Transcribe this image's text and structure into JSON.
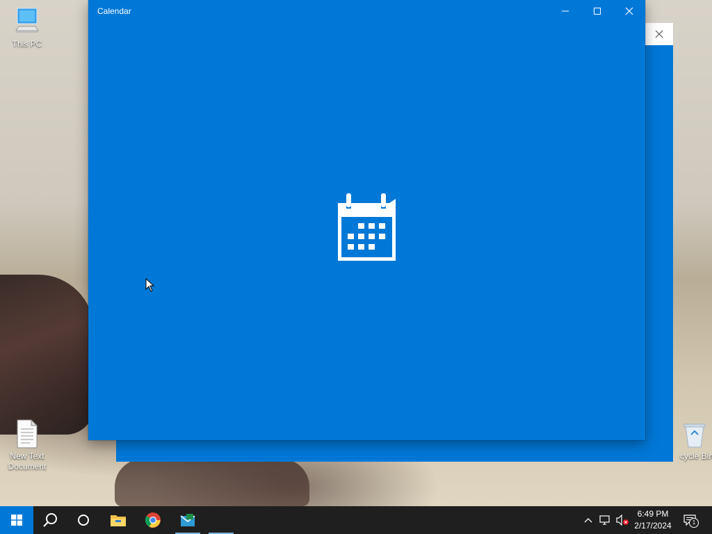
{
  "desktop": {
    "icons": [
      {
        "label": "This PC",
        "icon": "computer-icon"
      },
      {
        "label": "New Text Document",
        "icon": "text-document-icon"
      },
      {
        "label": "cycle Bin",
        "icon": "recycle-bin-icon"
      }
    ]
  },
  "window": {
    "title": "Calendar",
    "accent": "#0078d7",
    "splash_icon": "calendar-icon",
    "controls": [
      "minimize",
      "maximize",
      "close"
    ]
  },
  "background_window": {
    "controls": [
      "close"
    ]
  },
  "taskbar": {
    "background": "#1f1f1f",
    "items": [
      "start",
      "search",
      "cortana",
      "file-explorer",
      "chrome",
      "calendar-app",
      "mail-app"
    ],
    "tray": {
      "time": "6:49 PM",
      "date": "2/17/2024",
      "notification_count": "1"
    }
  }
}
